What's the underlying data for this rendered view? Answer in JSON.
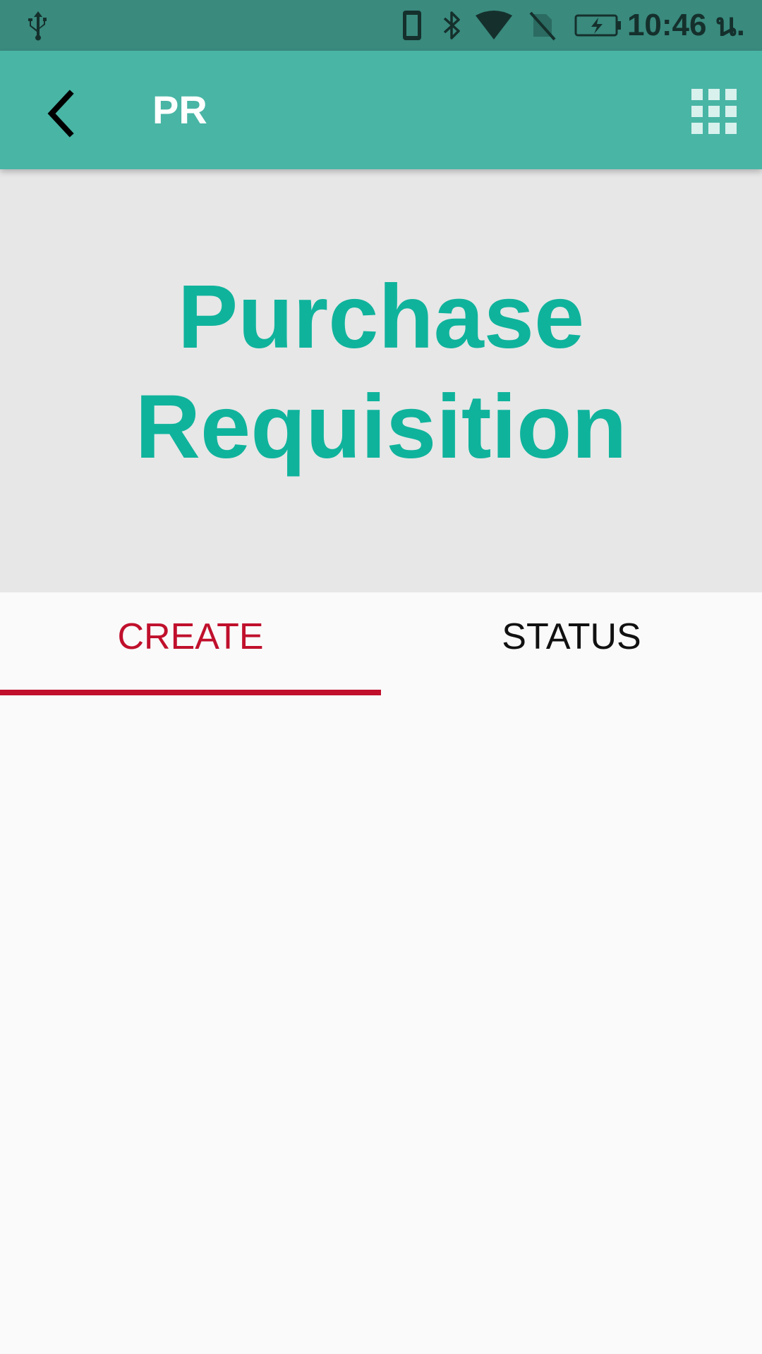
{
  "status_bar": {
    "time": "10:46 น.",
    "icons": [
      "usb-icon",
      "phone-icon",
      "bluetooth-icon",
      "wifi-icon",
      "no-sim-icon",
      "battery-charging-icon"
    ]
  },
  "app_bar": {
    "title": "PR",
    "back_icon": "chevron-left-icon",
    "menu_icon": "grid-apps-icon",
    "color": "#49b5a5"
  },
  "banner": {
    "title_line1": "Purchase",
    "title_line2": "Requisition",
    "title_color": "#0fb39c",
    "background": "#e7e7e7"
  },
  "tabs": [
    {
      "label": "CREATE",
      "selected": true
    },
    {
      "label": "STATUS",
      "selected": false
    }
  ],
  "colors": {
    "accent": "#c0102c",
    "status_bar": "#3a8a7e"
  }
}
